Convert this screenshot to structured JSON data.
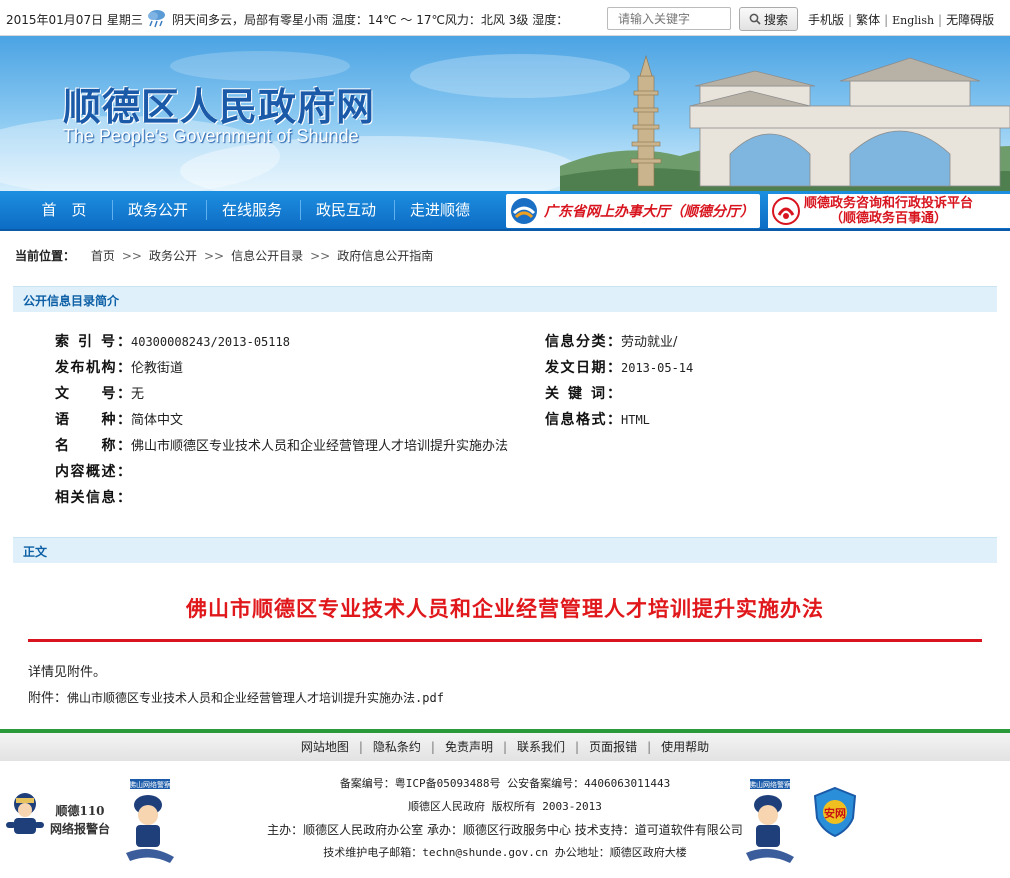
{
  "topbar": {
    "date": "2015年01月07日  星期三",
    "weather": "阴天间多云，局部有零星小雨 温度：14℃ ～ 17℃风力：北风 3级 湿度：",
    "search_placeholder": "请输入关键字",
    "search_label": "搜索",
    "links": [
      "手机版",
      "繁体",
      "English",
      "无障碍版"
    ]
  },
  "banner": {
    "title_cn": "顺德区人民政府网",
    "title_en": "The People's Government of Shunde"
  },
  "nav": {
    "items": [
      "首　页",
      "政务公开",
      "在线服务",
      "政民互动",
      "走进顺德"
    ],
    "promo1": "广东省网上办事大厅（顺德分厅）",
    "promo2_line1": "顺德政务咨询和行政投诉平台",
    "promo2_line2": "（顺德政务百事通）"
  },
  "breadcrumb": {
    "label": "当前位置：",
    "items": [
      "首页",
      "政务公开",
      "信息公开目录",
      "政府信息公开指南"
    ],
    "arrow": ">>"
  },
  "section_intro": "公开信息目录简介",
  "info": {
    "index_label": "索 引 号：",
    "index_value": "40300008243/2013-05118",
    "category_label": "信息分类：",
    "category_value": "劳动就业/",
    "org_label": "发布机构：",
    "org_value": "伦教街道",
    "date_label": "发文日期：",
    "date_value": "2013-05-14",
    "docno_label": "文　　号：",
    "docno_value": "无",
    "keyword_label": "关 键 词：",
    "keyword_value": "",
    "lang_label": "语　　种：",
    "lang_value": "简体中文",
    "format_label": "信息格式：",
    "format_value": "HTML",
    "name_label": "名　　称：",
    "name_value": "佛山市顺德区专业技术人员和企业经营管理人才培训提升实施办法",
    "summary_label": "内容概述：",
    "related_label": "相关信息："
  },
  "section_body": "正文",
  "article": {
    "title": "佛山市顺德区专业技术人员和企业经营管理人才培训提升实施办法",
    "line1": "详情见附件。",
    "attach_label": "附件：",
    "attach_name": "佛山市顺德区专业技术人员和企业经营管理人才培训提升实施办法.pdf"
  },
  "footer": {
    "nav": [
      "网站地图",
      "隐私条约",
      "免责声明",
      "联系我们",
      "页面报错",
      "使用帮助"
    ],
    "record": "备案编号：粤ICP备05093488号  公安备案编号：4406063011443",
    "copyright": "顺德区人民政府  版权所有  2003-2013",
    "sponsor": "主办：顺德区人民政府办公室  承办：顺德区行政服务中心  技术支持：道可道软件有限公司",
    "contact": "技术维护电子邮箱：techn@shunde.gov.cn  办公地址：顺德区政府大楼",
    "badge_line1": "顺德110",
    "badge_line2": "网络报警台",
    "police_label": "佛山网络警察",
    "shield_text": "安网"
  },
  "colors": {
    "nav_blue": "#0d6cc4",
    "title_red": "#e0171b",
    "section_bg": "#dff0fa",
    "footer_green": "#2a9a3b"
  }
}
